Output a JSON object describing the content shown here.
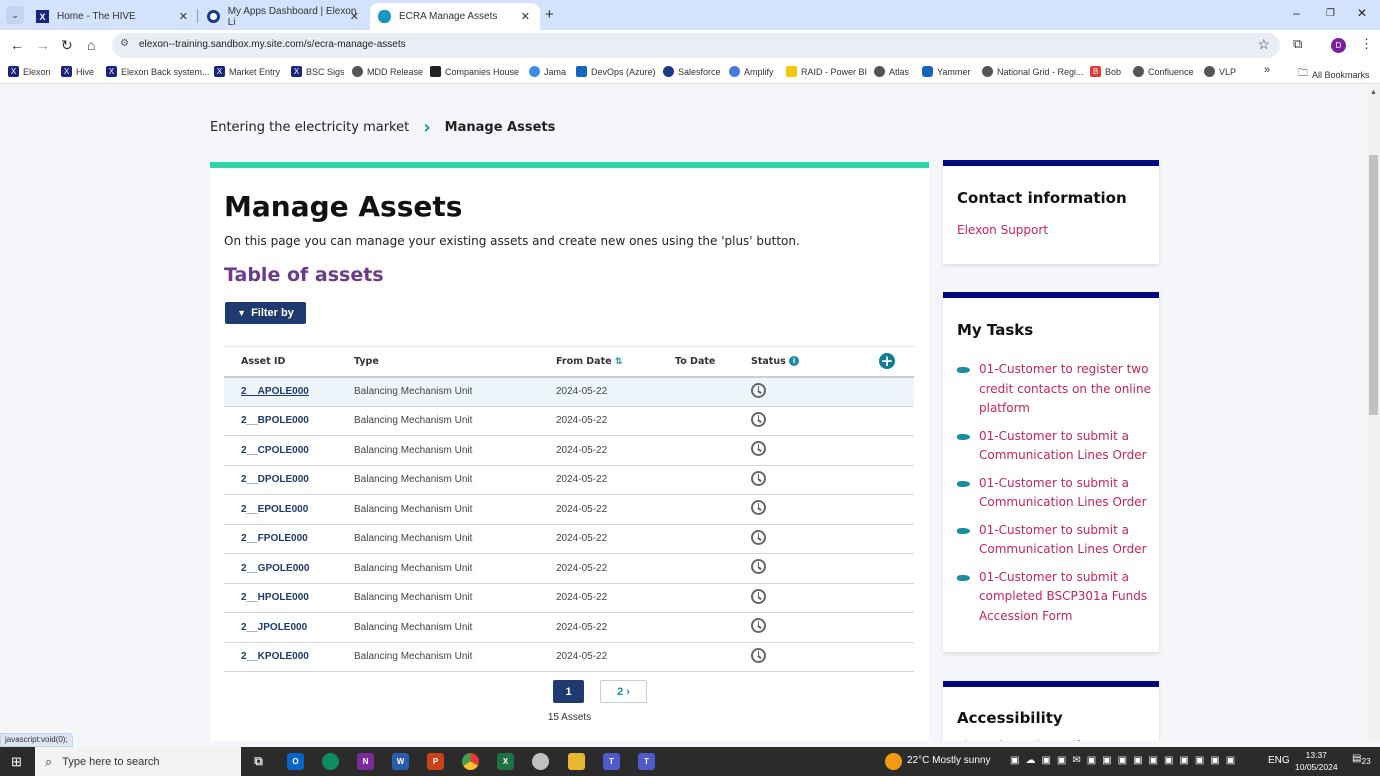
{
  "browser": {
    "tabs": [
      {
        "label": "Home - The HIVE",
        "icon": "elexon-x-icon"
      },
      {
        "label": "My Apps Dashboard | Elexon Li",
        "icon": "okta-icon"
      },
      {
        "label": "ECRA Manage Assets",
        "icon": "salesforce-cloud-icon",
        "active": true
      }
    ],
    "url": "elexon--training.sandbox.my.site.com/s/ecra-manage-assets",
    "profile_initial": "D",
    "bookmarks": [
      "Elexon",
      "Hive",
      "Elexon Back system...",
      "Market Entry",
      "BSC Sigs",
      "MDD Release",
      "Companies House",
      "Jama",
      "DevOps (Azure)",
      "Salesforce",
      "Amplify",
      "RAID - Power BI",
      "Atlas",
      "Yammer",
      "National Grid - Regi...",
      "Bob",
      "Confluence",
      "VLP"
    ],
    "all_bookmarks": "All Bookmarks",
    "status_hint": "javascript:void(0);"
  },
  "breadcrumb": {
    "parent": "Entering the electricity market",
    "current": "Manage Assets"
  },
  "main": {
    "title": "Manage Assets",
    "intro": "On this page you can manage your existing assets and create new ones using the 'plus' button.",
    "subtitle": "Table of assets",
    "filter_label": "Filter by",
    "columns": [
      "Asset ID",
      "Type",
      "From Date",
      "To Date",
      "Status"
    ],
    "rows": [
      {
        "id": "2__APOLE000",
        "type": "Balancing Mechanism Unit",
        "from": "2024-05-22",
        "to": "",
        "status": "pending"
      },
      {
        "id": "2__BPOLE000",
        "type": "Balancing Mechanism Unit",
        "from": "2024-05-22",
        "to": "",
        "status": "pending"
      },
      {
        "id": "2__CPOLE000",
        "type": "Balancing Mechanism Unit",
        "from": "2024-05-22",
        "to": "",
        "status": "pending"
      },
      {
        "id": "2__DPOLE000",
        "type": "Balancing Mechanism Unit",
        "from": "2024-05-22",
        "to": "",
        "status": "pending"
      },
      {
        "id": "2__EPOLE000",
        "type": "Balancing Mechanism Unit",
        "from": "2024-05-22",
        "to": "",
        "status": "pending"
      },
      {
        "id": "2__FPOLE000",
        "type": "Balancing Mechanism Unit",
        "from": "2024-05-22",
        "to": "",
        "status": "pending"
      },
      {
        "id": "2__GPOLE000",
        "type": "Balancing Mechanism Unit",
        "from": "2024-05-22",
        "to": "",
        "status": "pending"
      },
      {
        "id": "2__HPOLE000",
        "type": "Balancing Mechanism Unit",
        "from": "2024-05-22",
        "to": "",
        "status": "pending"
      },
      {
        "id": "2__JPOLE000",
        "type": "Balancing Mechanism Unit",
        "from": "2024-05-22",
        "to": "",
        "status": "pending"
      },
      {
        "id": "2__KPOLE000",
        "type": "Balancing Mechanism Unit",
        "from": "2024-05-22",
        "to": "",
        "status": "pending"
      }
    ],
    "pagination": {
      "current": "1",
      "next": "2"
    },
    "count": "15 Assets"
  },
  "sidebar": {
    "contact": {
      "title": "Contact information",
      "link": "Elexon Support"
    },
    "tasks": {
      "title": "My Tasks",
      "items": [
        "01-Customer to register two credit contacts on the online platform",
        "01-Customer to submit a Communication Lines Order",
        "01-Customer to submit a Communication Lines Order",
        "01-Customer to submit a Communication Lines Order",
        "01-Customer to submit a completed BSCP301a Funds Accession Form"
      ]
    },
    "accessibility": {
      "title": "Accessibility",
      "text": "Please let us know if you are"
    }
  },
  "taskbar": {
    "search_placeholder": "Type here to search",
    "weather": "22°C  Mostly sunny",
    "lang": "ENG",
    "time": "13:37",
    "date": "10/05/2024",
    "notifications": "23"
  },
  "colors": {
    "accent_green": "#2ed5a8",
    "navy": "#1e3a6e",
    "purple": "#6b3a8a",
    "link_red": "#c8245a",
    "teal": "#1a8ca0",
    "side_border": "#000a7e"
  }
}
